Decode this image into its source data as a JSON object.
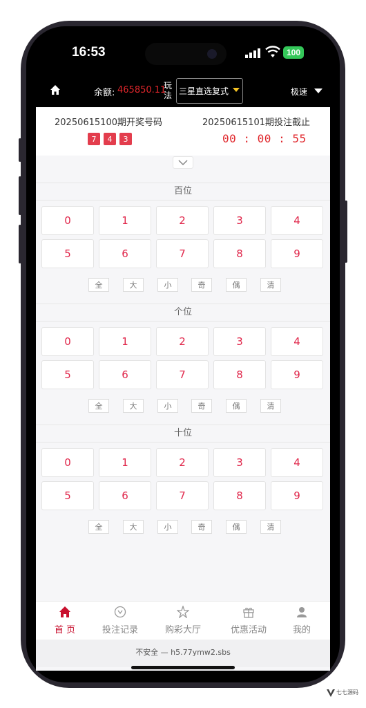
{
  "status_bar": {
    "time": "16:53",
    "battery": "100"
  },
  "header": {
    "balance_label": "余额:",
    "balance_value": "465850.11",
    "play_label": "玩法",
    "play_value": "三星直选复式",
    "speed_label": "极速"
  },
  "draw": {
    "issue_title": "20250615100期开奖号码",
    "numbers": [
      "7",
      "4",
      "3"
    ],
    "deadline_title": "20250615101期投注截止",
    "countdown": "00 : 00 : 55"
  },
  "sections": [
    {
      "title": "百位",
      "digits": [
        "0",
        "1",
        "2",
        "3",
        "4",
        "5",
        "6",
        "7",
        "8",
        "9"
      ]
    },
    {
      "title": "个位",
      "digits": [
        "0",
        "1",
        "2",
        "3",
        "4",
        "5",
        "6",
        "7",
        "8",
        "9"
      ]
    },
    {
      "title": "十位",
      "digits": [
        "0",
        "1",
        "2",
        "3",
        "4",
        "5",
        "6",
        "7",
        "8",
        "9"
      ]
    }
  ],
  "quick_tools": [
    "全",
    "大",
    "小",
    "奇",
    "偶",
    "清"
  ],
  "nav": [
    {
      "label": "首 页",
      "icon": "home-icon",
      "active": true
    },
    {
      "label": "投注记录",
      "icon": "bet-record-icon",
      "active": false
    },
    {
      "label": "购彩大厅",
      "icon": "lottery-hall-icon",
      "active": false
    },
    {
      "label": "优惠活动",
      "icon": "gift-icon",
      "active": false
    },
    {
      "label": "我的",
      "icon": "user-icon",
      "active": false
    }
  ],
  "url_bar": "不安全 — h5.77ymw2.sbs",
  "watermark": "七七源码",
  "colors": {
    "accent": "#c8102e",
    "number_red": "#e0264a",
    "ball_red": "#e33d4d",
    "caret_yellow": "#f6c324"
  }
}
